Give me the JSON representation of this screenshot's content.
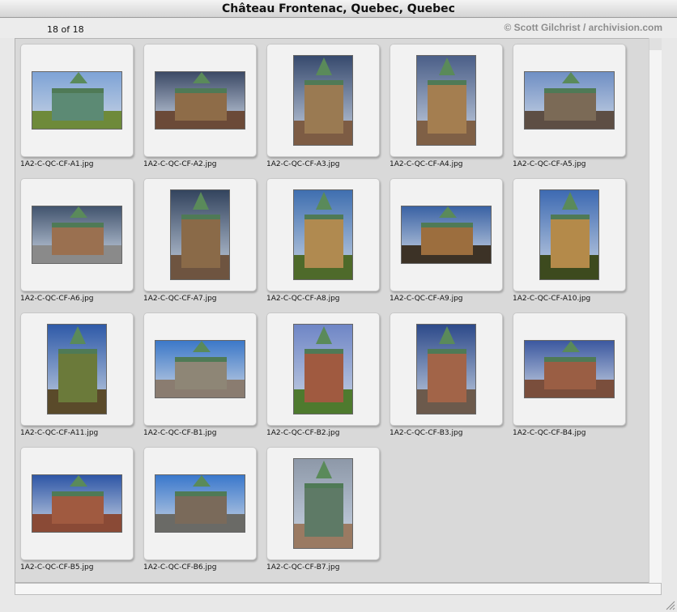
{
  "window": {
    "title": "Château Frontenac, Quebec, Quebec",
    "count": "18 of 18",
    "copyright": "© Scott Gilchrist / archivision.com"
  },
  "colors": {
    "panel": "#d9d9d9",
    "slide": "#f2f2f2",
    "copyright": "#8d8d8d"
  },
  "thumbnails": [
    {
      "filename": "1A2-C-QC-CF-A1.jpg",
      "orientation": "land",
      "sky": "#7ea3d6",
      "ground": "#6e8a3a",
      "building": "#5c8a74",
      "icon": "autumn-trees-image"
    },
    {
      "filename": "1A2-C-QC-CF-A2.jpg",
      "orientation": "land",
      "sky": "#3c4a66",
      "ground": "#6b4a38",
      "building": "#8e6c48",
      "icon": "castle-skyline-image"
    },
    {
      "filename": "1A2-C-QC-CF-A3.jpg",
      "orientation": "port",
      "sky": "#374a6e",
      "ground": "#7d5c44",
      "building": "#9a7a52",
      "icon": "castle-tower-image"
    },
    {
      "filename": "1A2-C-QC-CF-A4.jpg",
      "orientation": "port",
      "sky": "#4b5f88",
      "ground": "#7f6046",
      "building": "#a47e50",
      "icon": "castle-tower-image"
    },
    {
      "filename": "1A2-C-QC-CF-A5.jpg",
      "orientation": "land",
      "sky": "#6f8fc4",
      "ground": "#5d4e44",
      "building": "#7b6a56",
      "icon": "castle-skyline-image"
    },
    {
      "filename": "1A2-C-QC-CF-A6.jpg",
      "orientation": "land",
      "sky": "#42546e",
      "ground": "#8a8a8a",
      "building": "#9a7050",
      "icon": "river-view-image"
    },
    {
      "filename": "1A2-C-QC-CF-A7.jpg",
      "orientation": "port",
      "sky": "#33445e",
      "ground": "#6e5440",
      "building": "#8a6a48",
      "icon": "castle-tower-image"
    },
    {
      "filename": "1A2-C-QC-CF-A8.jpg",
      "orientation": "port",
      "sky": "#3f6fb0",
      "ground": "#4e6a2a",
      "building": "#b08a50",
      "icon": "castle-trees-image"
    },
    {
      "filename": "1A2-C-QC-CF-A9.jpg",
      "orientation": "land",
      "sky": "#3a62a4",
      "ground": "#3c3226",
      "building": "#9c6e3e",
      "icon": "castle-dusk-image"
    },
    {
      "filename": "1A2-C-QC-CF-A10.jpg",
      "orientation": "port",
      "sky": "#3d6ab2",
      "ground": "#3d4a1e",
      "building": "#b48a4a",
      "icon": "castle-sunlit-image"
    },
    {
      "filename": "1A2-C-QC-CF-A11.jpg",
      "orientation": "port",
      "sky": "#2f5aa8",
      "ground": "#5a4a2a",
      "building": "#6b7a3a",
      "icon": "castle-trees-image"
    },
    {
      "filename": "1A2-C-QC-CF-B1.jpg",
      "orientation": "land",
      "sky": "#3c78c8",
      "ground": "#8a7c70",
      "building": "#8e8676",
      "icon": "castle-wide-image"
    },
    {
      "filename": "1A2-C-QC-CF-B2.jpg",
      "orientation": "port",
      "sky": "#6f86c6",
      "ground": "#4e7a2e",
      "building": "#a05a40",
      "icon": "cannon-castle-image"
    },
    {
      "filename": "1A2-C-QC-CF-B3.jpg",
      "orientation": "port",
      "sky": "#2d4a8a",
      "ground": "#6c5a4c",
      "building": "#a26448",
      "icon": "castle-facade-image"
    },
    {
      "filename": "1A2-C-QC-CF-B4.jpg",
      "orientation": "land",
      "sky": "#3c58a0",
      "ground": "#7a4e3c",
      "building": "#9a5e44",
      "icon": "castle-facade-image"
    },
    {
      "filename": "1A2-C-QC-CF-B5.jpg",
      "orientation": "land",
      "sky": "#2e56a6",
      "ground": "#8a4a36",
      "building": "#a05a40",
      "icon": "castle-turrets-image"
    },
    {
      "filename": "1A2-C-QC-CF-B6.jpg",
      "orientation": "land",
      "sky": "#3a78cc",
      "ground": "#6a6a66",
      "building": "#7a6a5a",
      "icon": "castle-statue-image"
    },
    {
      "filename": "1A2-C-QC-CF-B7.jpg",
      "orientation": "port",
      "sky": "#8d98a8",
      "ground": "#9a7a62",
      "building": "#5e7a66",
      "icon": "turret-roof-image"
    }
  ]
}
